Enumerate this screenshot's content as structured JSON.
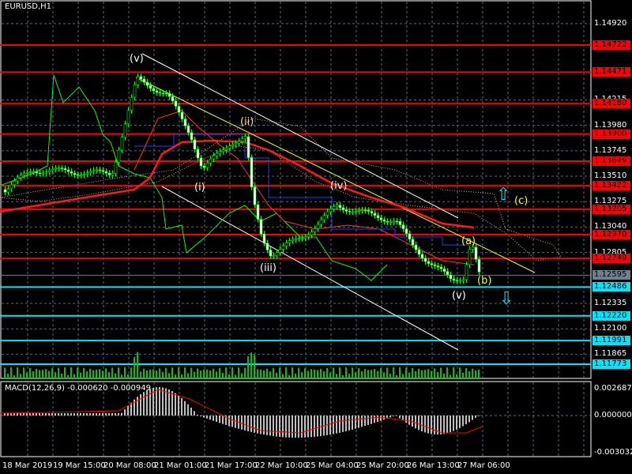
{
  "chart": {
    "symbol_title": "EURUSD,H1",
    "macd_title": "MACD(12,26,9) -0.000620 -0.000949",
    "price_axis": [
      "1.14920",
      "1.14215",
      "1.13980",
      "1.13745",
      "1.13510",
      "1.13275",
      "1.13040",
      "1.12805",
      "1.12335",
      "1.12100",
      "1.11865"
    ],
    "macd_axis": [
      "0.002687",
      "0.000000",
      "-0.003032"
    ],
    "time_axis": [
      "18 Mar 2019",
      "19 Mar 15:00",
      "20 Mar 08:00",
      "21 Mar 01:00",
      "21 Mar 17:00",
      "22 Mar 10:00",
      "25 Mar 04:00",
      "25 Mar 20:00",
      "26 Mar 13:00",
      "27 Mar 06:00"
    ],
    "resistance_levels": [
      "1.14722",
      "1.14471",
      "1.14180",
      "1.13900",
      "1.13649",
      "1.13422",
      "1.13205",
      "1.12970",
      "1.12749"
    ],
    "support_levels": [
      "1.12486",
      "1.12220",
      "1.11991",
      "1.11773"
    ],
    "current_price": "1.12595",
    "wave_labels": {
      "v1": "(v)",
      "i": "(i)",
      "ii": "(ii)",
      "iii": "(iii)",
      "iv": "(iv)",
      "v2": "(v)",
      "a": "(a)",
      "b": "(b)",
      "c": "(c)"
    },
    "colors": {
      "resistance": "#ff0000",
      "support": "#00e5ff",
      "current": "#708090",
      "bull": "#00ff00",
      "wave": "#ffff00"
    }
  }
}
